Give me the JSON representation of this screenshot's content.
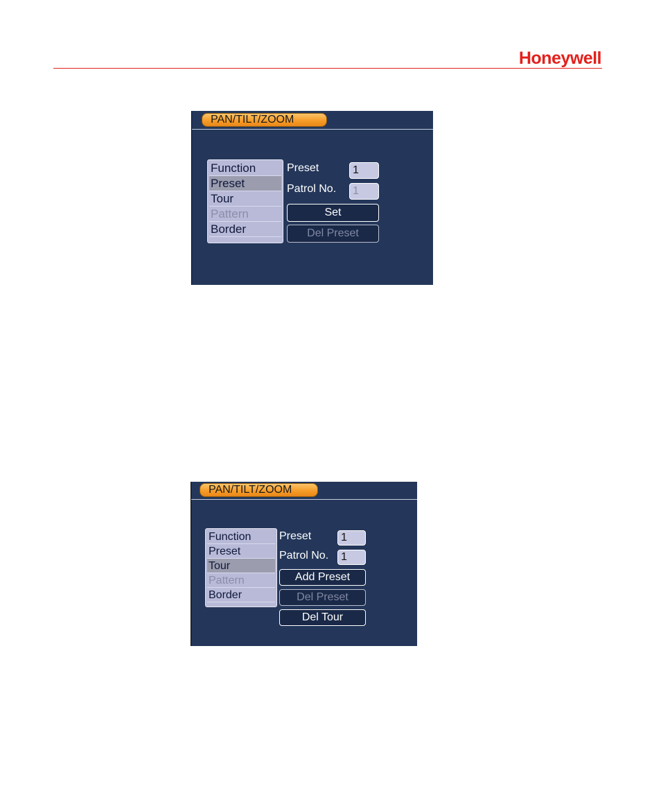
{
  "brand": {
    "logo_text": "Honeywell",
    "color": "#e2211c"
  },
  "colors": {
    "panel_bg": "#24375a",
    "tab_orange": "#f59a25",
    "list_bg": "#b8bad8",
    "selected_row": "#9b9dae"
  },
  "panels": [
    {
      "title": "PAN/TILT/ZOOM",
      "menu": [
        {
          "label": "Function",
          "state": "normal"
        },
        {
          "label": "Preset",
          "state": "selected"
        },
        {
          "label": "Tour",
          "state": "normal"
        },
        {
          "label": "Pattern",
          "state": "disabled"
        },
        {
          "label": "Border",
          "state": "normal"
        }
      ],
      "preset_label": "Preset",
      "preset_value": "1",
      "patrol_label": "Patrol No.",
      "patrol_value": "1",
      "buttons": [
        {
          "label": "Set",
          "state": "enabled"
        },
        {
          "label": "Del Preset",
          "state": "disabled"
        }
      ]
    },
    {
      "title": "PAN/TILT/ZOOM",
      "menu": [
        {
          "label": "Function",
          "state": "normal"
        },
        {
          "label": "Preset",
          "state": "normal"
        },
        {
          "label": "Tour",
          "state": "selected"
        },
        {
          "label": "Pattern",
          "state": "disabled"
        },
        {
          "label": "Border",
          "state": "normal"
        }
      ],
      "preset_label": "Preset",
      "preset_value": "1",
      "patrol_label": "Patrol No.",
      "patrol_value": "1",
      "buttons": [
        {
          "label": "Add Preset",
          "state": "enabled"
        },
        {
          "label": "Del Preset",
          "state": "disabled"
        },
        {
          "label": "Del Tour",
          "state": "enabled"
        }
      ]
    }
  ]
}
